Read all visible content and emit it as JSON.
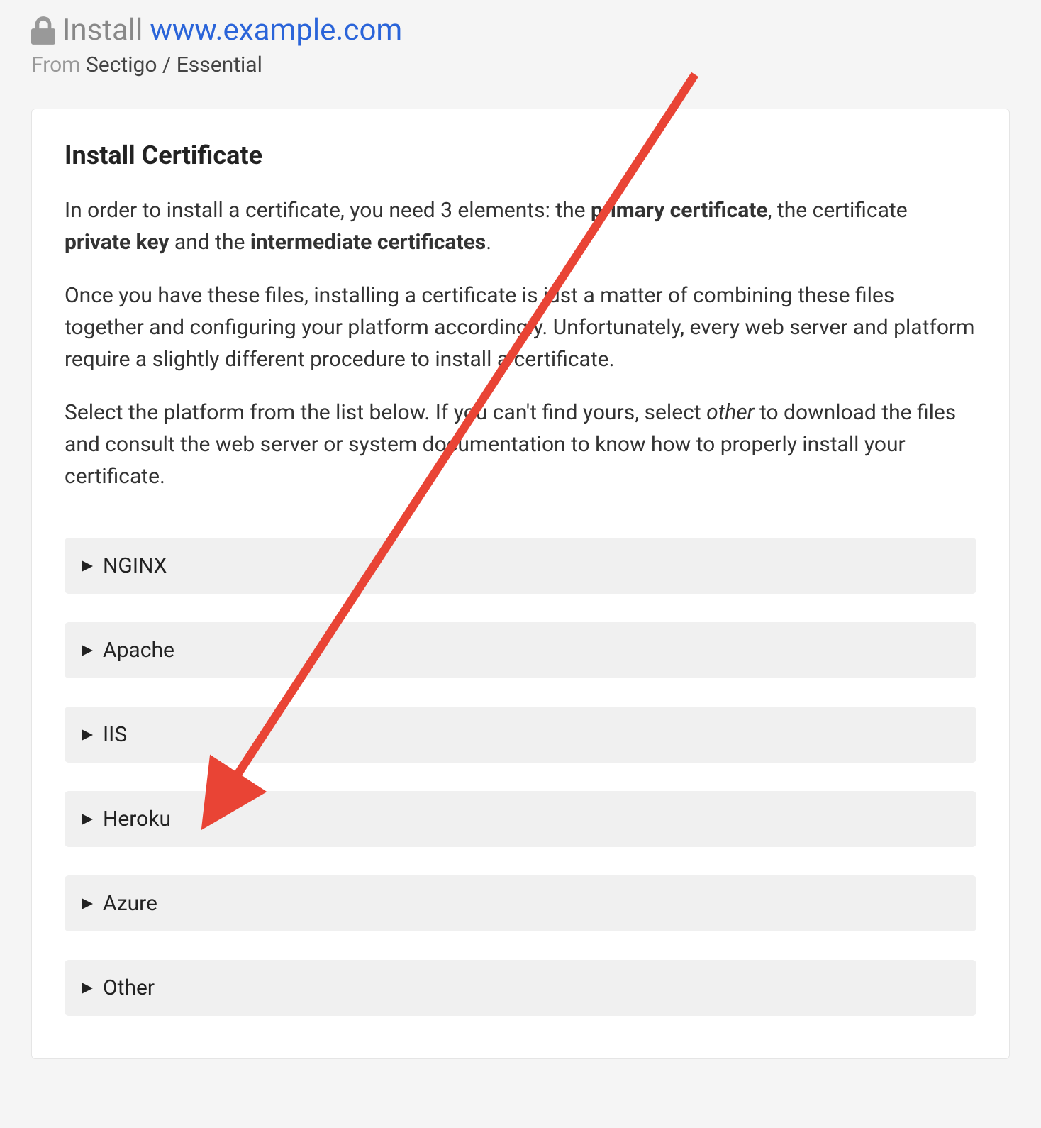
{
  "header": {
    "titlePrefix": "Install",
    "domain": "www.example.com",
    "fromLabel": "From",
    "provider": "Sectigo / Essential"
  },
  "card": {
    "heading": "Install Certificate",
    "para1_seg1": "In order to install a certificate, you need 3 elements: the ",
    "para1_b1": "primary certificate",
    "para1_seg2": ", the certificate ",
    "para1_b2": "private key",
    "para1_seg3": " and the ",
    "para1_b3": "intermediate certificates",
    "para1_seg4": ".",
    "para2": "Once you have these files, installing a certificate is just a matter of combining these files together and configuring your platform accordingly. Unfortunately, every web server and platform require a slightly different procedure to install a certificate.",
    "para3_seg1": "Select the platform from the list below. If you can't find yours, select ",
    "para3_italic": "other",
    "para3_seg2": " to download the files and consult the web server or system documentation to know how to properly install your certificate."
  },
  "platforms": {
    "items": [
      {
        "label": "NGINX"
      },
      {
        "label": "Apache"
      },
      {
        "label": "IIS"
      },
      {
        "label": "Heroku"
      },
      {
        "label": "Azure"
      },
      {
        "label": "Other"
      }
    ]
  },
  "annotation": {
    "arrowColor": "#e94435"
  }
}
